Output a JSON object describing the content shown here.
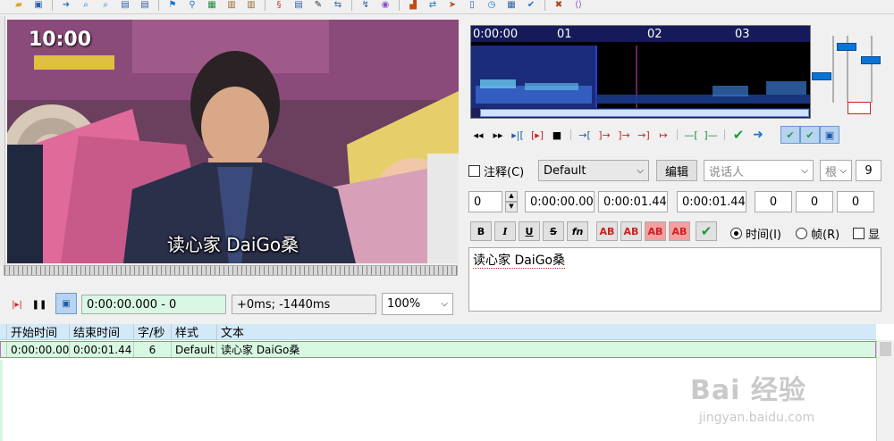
{
  "toolbar": {
    "icons": [
      "open-icon",
      "save-icon",
      "arrow-right-icon",
      "zoom-in-icon",
      "zoom-out-icon",
      "video-icon",
      "video-zoom-icon",
      "jump-icon",
      "marker-icon",
      "fonts-icon",
      "film-icon",
      "attachments-icon",
      "spell-icon",
      "properties-icon",
      "styles-icon",
      "translate-icon",
      "resample-icon",
      "kanji-icon",
      "timing-icon",
      "audio-icon",
      "select-icon",
      "clock-icon",
      "check-icon",
      "tools-icon",
      "automation-icon"
    ]
  },
  "video": {
    "clock_text": "10:00",
    "subtitle": "读心家 DaiGo桑"
  },
  "playback": {
    "time": "0:00:00.000 - 0",
    "offset": "+0ms; -1440ms",
    "zoom": "100%"
  },
  "audio": {
    "ruler": [
      "0:00:00",
      "01",
      "02",
      "03"
    ]
  },
  "edit": {
    "comment_label": "注释(C)",
    "style": "Default",
    "edit_button": "编辑",
    "actor_placeholder": "说话人",
    "effect_label": "根",
    "layer_right": "9",
    "layer": "0",
    "start_time": "0:00:00.00",
    "end_time": "0:00:01.44",
    "duration": "0:00:01.44",
    "margin_l": "0",
    "margin_r": "0",
    "margin_v": "0",
    "bold": "B",
    "italic": "I",
    "underline": "U",
    "strike": "S",
    "fn": "fn",
    "color_labels": [
      "AB",
      "AB",
      "AB",
      "AB"
    ],
    "time_radio": "时间(I)",
    "frame_radio": "帧(R)",
    "show_label": "显",
    "text": "读心家 DaiGo桑"
  },
  "grid": {
    "columns": [
      "",
      "开始时间",
      "结束时间",
      "字/秒",
      "样式",
      "文本"
    ],
    "rows": [
      {
        "num": "",
        "start": "0:00:00.00",
        "end": "0:00:01.44",
        "cps": "6",
        "style": "Default",
        "text": "读心家 DaiGo桑"
      }
    ]
  },
  "watermark": {
    "brand": "Bai 经验",
    "url": "jingyan.baidu.com"
  },
  "colors": {
    "accent_blue": "#0a74d6",
    "audio_bg": "#000000",
    "grid_header": "#d4e9f7",
    "grid_row": "#d8f7e3",
    "timebox": "#d9f7e4"
  }
}
